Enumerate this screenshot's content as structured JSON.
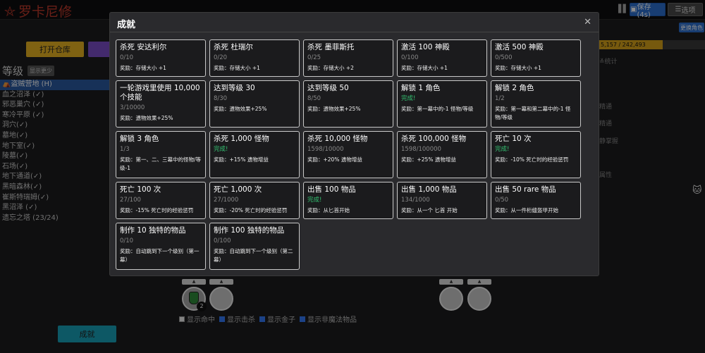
{
  "app": {
    "title": "罗卡尼修"
  },
  "header": {
    "pause_icon": "pause-icon",
    "save_label": "保存 (4s)",
    "options_label": "选项",
    "change_role_label": "更换角色"
  },
  "main": {
    "warehouse_label": "打开仓库",
    "achievements_label": "成就"
  },
  "levels": {
    "title": "等级",
    "show_less": "显示更少",
    "zones": [
      "盗贼营地 (H)",
      "血之沼泽 (✓)",
      "邪恶巢穴 (✓)",
      "寒冷平原 (✓)",
      "洞穴(✓)",
      "墓地(✓)",
      "地下室(✓)",
      "陵墓(✓)",
      "石场(✓)",
      "地下通道(✓)",
      "黑暗森林(✓)",
      "崔斯特瑞姆(✓)",
      "黑沼泽 (✓)",
      "遗忘之塔 (23/24)"
    ]
  },
  "right_panel": {
    "xp_text": "5,157 / 242,493",
    "xp_fraction": 0.6,
    "stats_link": "统计",
    "lines": [
      "精通",
      "精通",
      "静掌握",
      "属性"
    ]
  },
  "filters": [
    "显示命中",
    "显示击杀",
    "显示金子",
    "显示非魔法物品"
  ],
  "filters_checked": [
    false,
    true,
    true,
    true
  ],
  "belt": {
    "potion_count": "2"
  },
  "modal": {
    "title": "成就",
    "close_icon": "close-icon",
    "achievements": [
      {
        "title": "杀死 安达利尔",
        "progress": "0/10",
        "reward": "奖励：存储大小 +1",
        "done": false
      },
      {
        "title": "杀死 杜瑞尔",
        "progress": "0/20",
        "reward": "奖励：存储大小 +1",
        "done": false
      },
      {
        "title": "杀死 墨菲斯托",
        "progress": "0/25",
        "reward": "奖励：存储大小 +2",
        "done": false
      },
      {
        "title": "激活 100 神殿",
        "progress": "0/100",
        "reward": "奖励：存储大小 +1",
        "done": false
      },
      {
        "title": "激活 500 神殿",
        "progress": "0/500",
        "reward": "奖励：存储大小 +1",
        "done": false
      },
      {
        "title": "一轮游戏里使用 10,000 个技能",
        "progress": "3/10000",
        "reward": "奖励：遗物效果+25%",
        "done": false
      },
      {
        "title": "达到等级 30",
        "progress": "8/30",
        "reward": "奖励：遗物效果+25%",
        "done": false
      },
      {
        "title": "达到等级 50",
        "progress": "8/50",
        "reward": "奖励：遗物效果+25%",
        "done": false
      },
      {
        "title": "解锁 1 角色",
        "progress": "完成!",
        "reward": "奖励：第一幕中的-1 怪物/等级",
        "done": true
      },
      {
        "title": "解锁 2 角色",
        "progress": "1/2",
        "reward": "奖励：第一幕和第二幕中的-1 怪物/等级",
        "done": false
      },
      {
        "title": "解锁 3 角色",
        "progress": "1/3",
        "reward": "奖励：第一、二、三幕中的怪物/等级-1",
        "done": false
      },
      {
        "title": "杀死 1,000 怪物",
        "progress": "完成!",
        "reward": "奖励：+15% 遗物增益",
        "done": true
      },
      {
        "title": "杀死 10,000 怪物",
        "progress": "1598/10000",
        "reward": "奖励：+20% 遗物增益",
        "done": false
      },
      {
        "title": "杀死 100,000 怪物",
        "progress": "1598/100000",
        "reward": "奖励：+25% 遗物增益",
        "done": false
      },
      {
        "title": "死亡 10 次",
        "progress": "完成!",
        "reward": "奖励：-10% 死亡时的经验惩罚",
        "done": true
      },
      {
        "title": "死亡 100 次",
        "progress": "27/100",
        "reward": "奖励：-15% 死亡时的经验惩罚",
        "done": false
      },
      {
        "title": "死亡 1,000 次",
        "progress": "27/1000",
        "reward": "奖励：-20% 死亡时的经验惩罚",
        "done": false
      },
      {
        "title": "出售 100 物品",
        "progress": "完成!",
        "reward": "奖励：从匕首开始",
        "done": true
      },
      {
        "title": "出售 1,000 物品",
        "progress": "134/1000",
        "reward": "奖励：从一个 匕首 开始",
        "done": false
      },
      {
        "title": "出售 50 rare 物品",
        "progress": "0/50",
        "reward": "奖励：从一件桁缝盔甲开始",
        "done": false
      },
      {
        "title": "制作 10 独特的物品",
        "progress": "0/10",
        "reward": "奖励：自动跳到下一个级别（第一幕）",
        "done": false
      },
      {
        "title": "制作 100 独特的物品",
        "progress": "0/100",
        "reward": "奖励：自动跳到下一个级别（第二幕）",
        "done": false
      }
    ]
  }
}
